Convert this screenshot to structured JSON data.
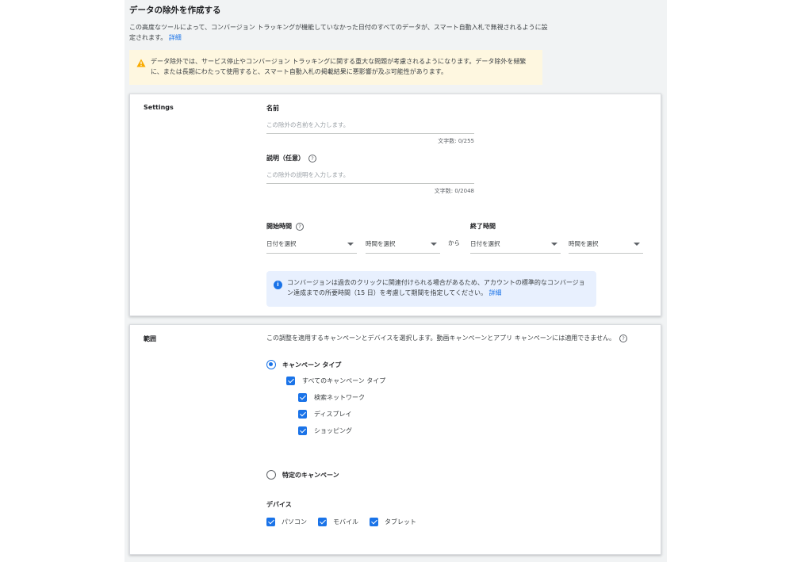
{
  "page": {
    "title": "データの除外を作成する",
    "intro": "この高度なツールによって、コンバージョン トラッキングが機能していなかった日付のすべてのデータが、スマート自動入札で無視されるように設定されます。",
    "intro_link": "詳細"
  },
  "warning": {
    "icon": "warning-icon",
    "text": "データ除外では、サービス停止やコンバージョン トラッキングに関する重大な問題が考慮されるようになります。データ除外を頻繁に、または長期にわたって使用すると、スマート自動入札の掲載結果に悪影響が及ぶ可能性があります。"
  },
  "settings": {
    "section_label": "Settings",
    "name": {
      "label": "名前",
      "placeholder": "この除外の名前を入力します。",
      "counter": "文字数: 0/255"
    },
    "description": {
      "label": "説明（任意）",
      "placeholder": "この除外の説明を入力します。",
      "counter": "文字数: 0/2048"
    },
    "start": {
      "label": "開始時間",
      "date_placeholder": "日付を選択",
      "time_placeholder": "時間を選択"
    },
    "from_text": "から",
    "end": {
      "label": "終了時間",
      "date_placeholder": "日付を選択",
      "time_placeholder": "時間を選択"
    },
    "info": {
      "text": "コンバージョンは過去のクリックに関連付けられる場合があるため、アカウントの標準的なコンバージョン達成までの所要時間（15 日）を考慮して期間を指定してください。",
      "link": "詳細"
    }
  },
  "range": {
    "section_label": "範囲",
    "description": "この調整を適用するキャンペーンとデバイスを選択します。動画キャンペーンとアプリ キャンペーンには適用できません。",
    "campaign_type_label": "キャンペーン タイプ",
    "all_types_label": "すべてのキャンペーン タイプ",
    "sub_types": [
      "検索ネットワーク",
      "ディスプレイ",
      "ショッピング"
    ],
    "specific_campaign_label": "特定のキャンペーン",
    "devices_label": "デバイス",
    "devices": [
      "パソコン",
      "モバイル",
      "タブレット"
    ]
  },
  "colors": {
    "accent": "#1a73e8",
    "warning_bg": "#fef7e0",
    "info_bg": "#e8f0fe",
    "warning_icon": "#f9ab00"
  }
}
